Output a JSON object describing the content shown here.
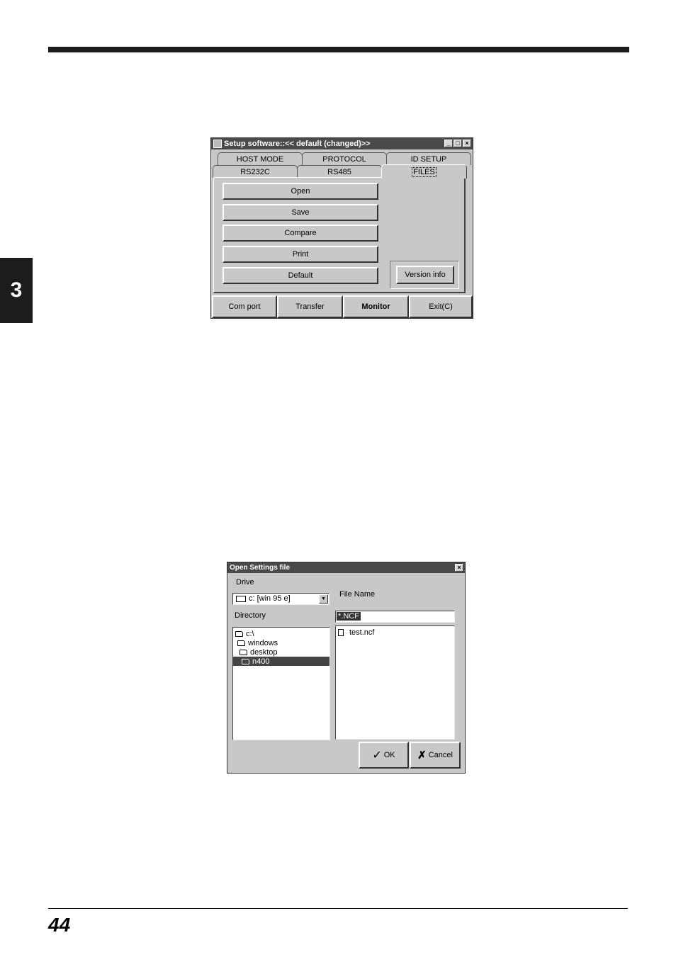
{
  "page": {
    "chapter": "3",
    "page_number": "44"
  },
  "setup_window": {
    "title": "Setup software::<< default (changed)>>",
    "tabs_row1": [
      "HOST MODE",
      "PROTOCOL",
      "ID SETUP"
    ],
    "tabs_row2": [
      "RS232C",
      "RS485",
      "FILES"
    ],
    "active_tab": "FILES",
    "buttons": {
      "open": "Open",
      "save": "Save",
      "compare": "Compare",
      "print": "Print",
      "default": "Default",
      "version_info": "Version info"
    },
    "bottom_bar": {
      "com_port": "Com port",
      "transfer": "Transfer",
      "monitor": "Monitor",
      "exit": "Exit(C)"
    }
  },
  "open_dialog": {
    "title": "Open Settings file",
    "drive_label": "Drive",
    "drive_value": "c: [win 95 e]",
    "file_name_label": "File Name",
    "file_name_value": "*.NCF",
    "directory_label": "Directory",
    "directory_tree": [
      "c:\\",
      "windows",
      "desktop",
      "n400"
    ],
    "files": [
      "test.ncf"
    ],
    "ok_label": "OK",
    "cancel_label": "Cancel"
  }
}
